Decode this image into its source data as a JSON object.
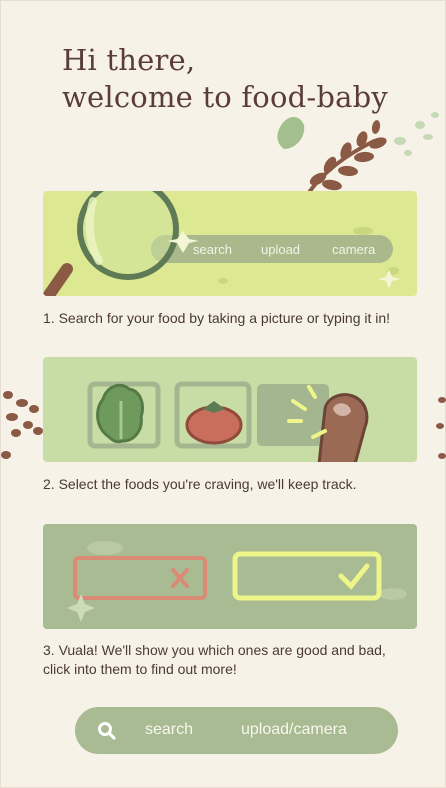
{
  "header": {
    "title_line1": "Hi there,",
    "title_line2": "welcome to food-baby"
  },
  "steps": [
    {
      "caption": "1. Search for your food by taking a picture or typing it in!",
      "illustration": {
        "labels": [
          "search",
          "upload",
          "camera"
        ],
        "background": "#dde892",
        "pill": "#a9b98c"
      }
    },
    {
      "caption": "2. Select the foods you're craving, we'll keep track.",
      "illustration": {
        "background": "#c8dca6"
      }
    },
    {
      "caption": "3. Vuala! We'll show you which ones are good and bad, click into them to find out more!",
      "illustration": {
        "background": "#a9bb92"
      }
    }
  ],
  "bottom_bar": {
    "search_label": "search",
    "upload_label": "upload/camera",
    "icon": "search-icon"
  },
  "colors": {
    "background": "#f7f2e8",
    "text": "#4a3a33",
    "title": "#5a3e35",
    "accent_green": "#a9bb92",
    "leaf_brown": "#8b5a45"
  }
}
